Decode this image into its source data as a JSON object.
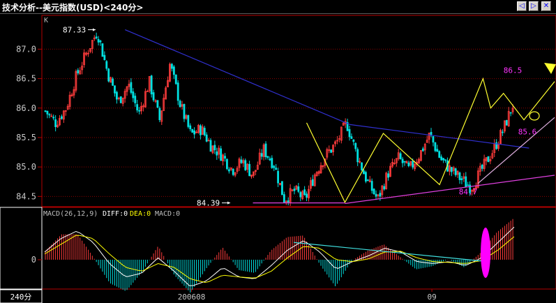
{
  "window": {
    "title": "技术分析--美元指数(USD)<240分>",
    "buttons": [
      {
        "name": "prev-button",
        "glyph": "◁"
      },
      {
        "name": "next-button",
        "glyph": "▷"
      },
      {
        "name": "close-button",
        "glyph": "✕"
      }
    ]
  },
  "chart_data": [
    {
      "type": "candlestick",
      "panel": "price",
      "panel_label": "K",
      "ylim": [
        84.35,
        87.55
      ],
      "yticks": [
        84.5,
        85.0,
        85.5,
        86.0,
        86.5,
        87.0
      ],
      "ytick_labels": [
        "84.5",
        "85.0",
        "85.5",
        "86.0",
        "86.5",
        "87.0"
      ],
      "grid": true,
      "colors": {
        "up": "#ff3c3c",
        "down": "#00e0e0",
        "grid": "#8b0000",
        "axis": "#b40000"
      },
      "close_path": [
        85.95,
        85.75,
        86.0,
        86.55,
        86.95,
        87.3,
        86.6,
        86.1,
        86.4,
        85.9,
        86.45,
        85.8,
        86.75,
        86.05,
        85.55,
        85.65,
        85.35,
        85.2,
        84.95,
        85.1,
        84.85,
        85.3,
        85.05,
        84.45,
        84.6,
        84.45,
        84.9,
        85.2,
        85.4,
        85.75,
        85.2,
        84.75,
        84.45,
        84.9,
        85.15,
        84.95,
        85.2,
        85.55,
        85.15,
        84.95,
        84.8,
        84.65,
        84.95,
        85.25,
        85.6,
        86.05
      ],
      "annotations": [
        {
          "label": "87.33",
          "value": 87.33,
          "color": "#ffffff"
        },
        {
          "label": "84.39",
          "value": 84.39,
          "color": "#ffffff"
        },
        {
          "label": "84.4",
          "value": 84.4,
          "color": "#ff33ff"
        },
        {
          "label": "84.7",
          "value": 84.7,
          "color": "#ff33ff"
        },
        {
          "label": "86.5",
          "value": 86.5,
          "color": "#ff33ff"
        },
        {
          "label": "85.6",
          "value": 85.6,
          "color": "#ff33ff"
        }
      ],
      "trendlines": [
        {
          "name": "downtrend-resistance",
          "color": "#3030d0",
          "points": [
            [
              0.16,
              87.33
            ],
            [
              0.6,
              85.72
            ]
          ]
        },
        {
          "name": "neckline",
          "color": "#3030d0",
          "points": [
            [
              0.6,
              85.72
            ],
            [
              0.95,
              85.32
            ]
          ]
        },
        {
          "name": "support-line",
          "color": "#e040e0",
          "points": [
            [
              0.59,
              84.38
            ],
            [
              1.0,
              84.86
            ]
          ]
        },
        {
          "name": "lower-support",
          "color": "#e040e0",
          "points": [
            [
              0.41,
              84.39
            ],
            [
              0.59,
              84.39
            ]
          ]
        },
        {
          "name": "rising-support",
          "color": "#e0b0e0",
          "points": [
            [
              0.85,
              84.72
            ],
            [
              1.0,
              85.84
            ]
          ]
        },
        {
          "name": "wave-pattern",
          "color": "#ffff30",
          "points": [
            [
              0.515,
              85.75
            ],
            [
              0.59,
              84.4
            ],
            [
              0.665,
              85.57
            ],
            [
              0.775,
              84.7
            ],
            [
              0.86,
              86.5
            ],
            [
              0.875,
              86.0
            ],
            [
              0.9,
              86.25
            ],
            [
              0.94,
              85.8
            ],
            [
              1.0,
              86.45
            ]
          ]
        }
      ]
    },
    {
      "type": "histogram",
      "panel": "macd",
      "indicator_label": "MACD(26,12,9)",
      "legend": [
        {
          "name": "DIFF",
          "value": "0",
          "color": "#ffffff"
        },
        {
          "name": "DEA",
          "value": "0",
          "color": "#ffff00"
        },
        {
          "name": "MACD",
          "value": "0",
          "color": "#c0c0c0"
        }
      ],
      "ylim": [
        -1,
        1
      ],
      "yticks": [
        0
      ],
      "ytick_labels": [
        "0"
      ],
      "diff_path": [
        0.2,
        0.55,
        0.75,
        0.45,
        -0.1,
        -0.45,
        -0.35,
        0.05,
        -0.3,
        -0.7,
        -0.55,
        -0.2,
        -0.45,
        -0.5,
        -0.15,
        0.25,
        0.5,
        0.2,
        -0.25,
        -0.05,
        0.1,
        0.3,
        0.2,
        -0.05,
        -0.1,
        -0.05,
        -0.15,
        0.05,
        0.45,
        0.85
      ],
      "dea_path": [
        0.15,
        0.4,
        0.65,
        0.55,
        0.15,
        -0.2,
        -0.3,
        -0.1,
        -0.2,
        -0.5,
        -0.6,
        -0.4,
        -0.45,
        -0.48,
        -0.3,
        0.05,
        0.35,
        0.3,
        0.0,
        -0.05,
        0.02,
        0.2,
        0.22,
        0.05,
        -0.05,
        -0.07,
        -0.1,
        -0.02,
        0.25,
        0.6
      ],
      "annotations": [
        {
          "name": "divergence-line",
          "color": "#40e0e0",
          "points": [
            [
              0.49,
              0.45
            ],
            [
              0.87,
              -0.05
            ]
          ]
        },
        {
          "name": "crossover-highlight",
          "color": "#ff00ff",
          "at": 0.865
        }
      ]
    }
  ],
  "axis": {
    "timeframe_label": "240分",
    "x_labels": [
      {
        "label": "200608",
        "pos": 0.29
      },
      {
        "label": "09",
        "pos": 0.76
      }
    ]
  }
}
